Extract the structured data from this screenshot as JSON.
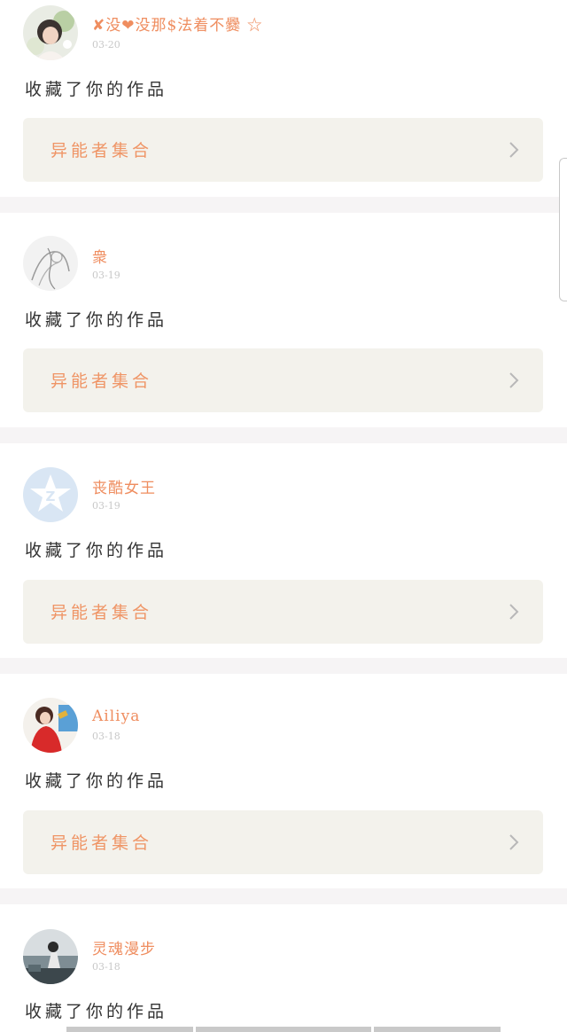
{
  "notifications": [
    {
      "username": "✘没❤没那$法着不爨 ☆",
      "date": "03-20",
      "action": "收藏了你的作品",
      "work_title": "异能者集合",
      "avatar_icon": "user-photo-flower-icon"
    },
    {
      "username": "衆",
      "date": "03-19",
      "action": "收藏了你的作品",
      "work_title": "异能者集合",
      "avatar_icon": "user-photo-sketch-icon"
    },
    {
      "username": "丧酷女王",
      "date": "03-19",
      "action": "收藏了你的作品",
      "work_title": "异能者集合",
      "avatar_icon": "default-z-avatar-icon"
    },
    {
      "username": "Ailiya",
      "date": "03-18",
      "action": "收藏了你的作品",
      "work_title": "异能者集合",
      "avatar_icon": "user-photo-red-dress-icon"
    },
    {
      "username": "灵魂漫步",
      "date": "03-18",
      "action": "收藏了你的作品",
      "work_title": "异能者集合",
      "avatar_icon": "user-photo-seaside-icon"
    }
  ],
  "colors": {
    "accent": "#ef8d5f",
    "box_bg": "#f3f2ec",
    "divider": "#f6f4f5",
    "text": "#333333",
    "date": "#c8c8c8"
  }
}
